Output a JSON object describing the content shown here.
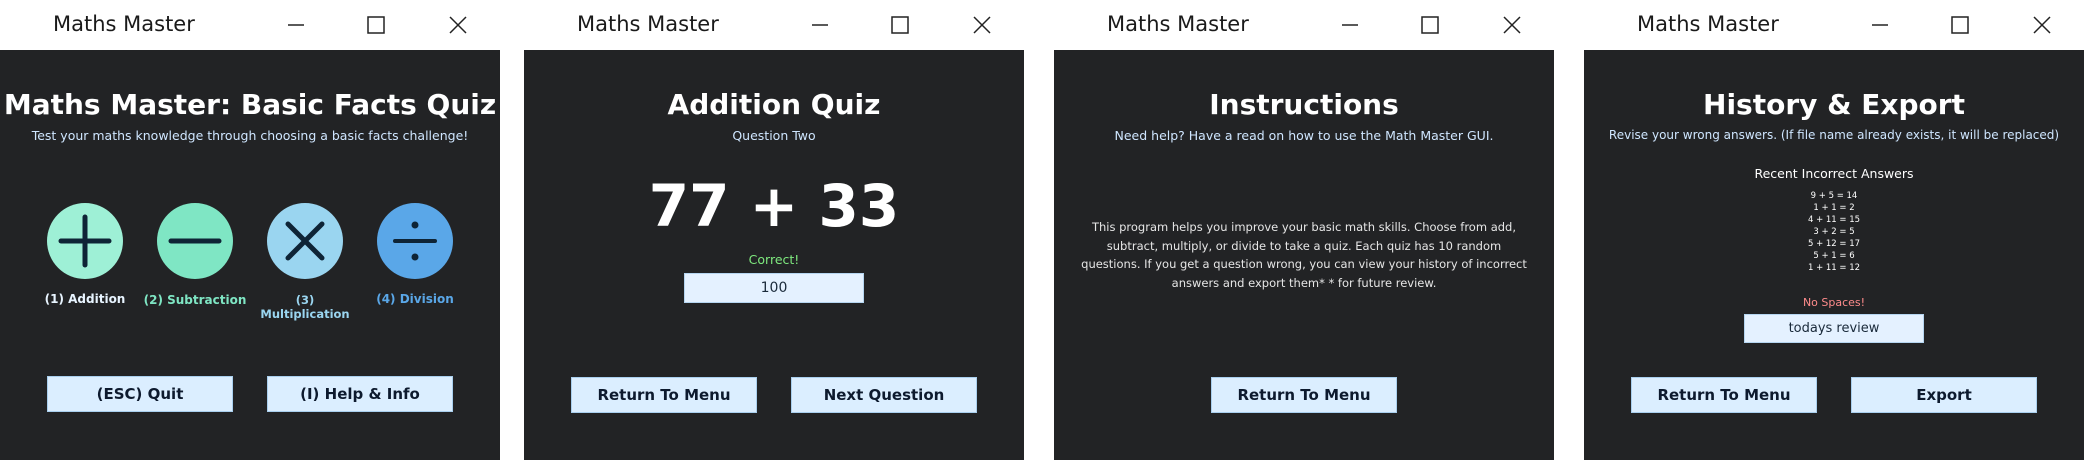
{
  "app_title": "Maths Master",
  "window_controls": {
    "minimize": "minimize-icon",
    "maximize": "maximize-icon",
    "close": "close-icon"
  },
  "menu": {
    "title": "Maths Master: Basic Facts Quiz",
    "subtitle": "Test your maths knowledge through choosing a basic facts challenge!",
    "operations": [
      {
        "label": "(1) Addition",
        "icon": "plus-icon",
        "color": "#9ef0d6",
        "label_color": "#e8f4ff"
      },
      {
        "label": "(2) Subtraction",
        "icon": "minus-icon",
        "color": "#7fe6c4",
        "label_color": "#7fe6c4"
      },
      {
        "label": "(3) Multiplication",
        "icon": "times-icon",
        "color": "#9ad5f0",
        "label_color": "#9ad5f0"
      },
      {
        "label": "(4) Division",
        "icon": "divide-icon",
        "color": "#5aa7e8",
        "label_color": "#5aa7e8"
      }
    ],
    "quit_label": "(ESC) Quit",
    "help_label": "(I) Help & Info"
  },
  "quiz": {
    "title": "Addition Quiz",
    "question_number": "Question Two",
    "expression": "77 + 33",
    "feedback": "Correct!",
    "feedback_color": "#7ee87e",
    "answer_value": "100",
    "return_label": "Return To Menu",
    "next_label": "Next Question"
  },
  "instructions": {
    "title": "Instructions",
    "subtitle": "Need help? Have a read on how to use the Math Master GUI.",
    "body_lines": [
      "This program helps you improve your basic math skills. Choose from add,",
      "subtract, multiply, or divide to take a quiz. Each quiz has 10 random",
      "questions. If you get a question wrong, you can view your history of incorrect",
      "answers and export them* * for future review."
    ],
    "return_label": "Return To Menu"
  },
  "history": {
    "title": "History & Export",
    "subtitle": "Revise your wrong answers. (If file name already exists, it will be replaced)",
    "list_heading": "Recent Incorrect Answers",
    "entries": [
      "9 + 5 = 14",
      "1 + 1 = 2",
      "4 + 11 = 15",
      "3 + 2 = 5",
      "5 + 12 = 17",
      "5 + 1 = 6",
      "1 + 11 = 12"
    ],
    "error": "No Spaces!",
    "error_color": "#ff8c8c",
    "filename_value": "todays review",
    "return_label": "Return To Menu",
    "export_label": "Export"
  }
}
